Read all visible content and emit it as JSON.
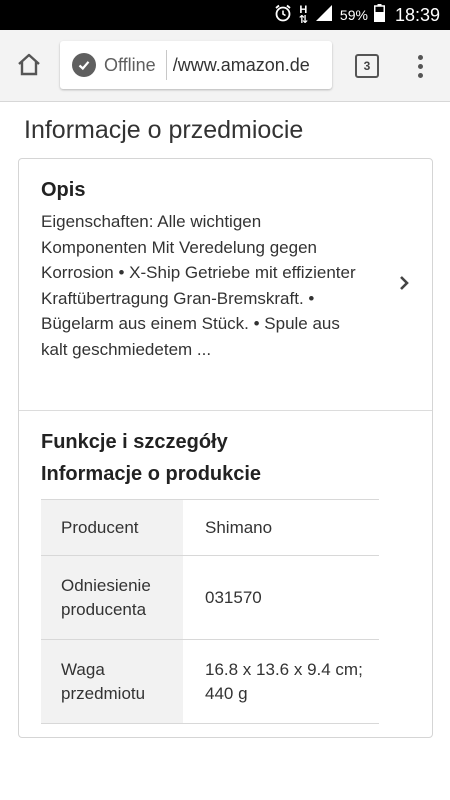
{
  "status_bar": {
    "network_label": "H",
    "battery": "59%",
    "time": "18:39"
  },
  "browser": {
    "offline_label": "Offline",
    "url": "/www.amazon.de",
    "tab_count": "3",
    "icons": [
      "home-icon",
      "offline-check-icon",
      "tabs-icon",
      "overflow-menu-icon"
    ]
  },
  "page": {
    "title": "Informacje o przedmiocie",
    "description": {
      "title": "Opis",
      "text": "Eigenschaften: Alle wichtigen Komponenten Mit Veredelung gegen Korrosion • X-Ship Getriebe mit effizienter Kraftübertragung Gran-Bremskraft. • Bügelarm aus einem Stück. • Spule aus kalt geschmiedetem ..."
    },
    "features": {
      "title": "Funkcje i szczegóły",
      "info_title": "Informacje o produkcie",
      "rows": [
        {
          "label": "Producent",
          "value": "Shimano"
        },
        {
          "label": "Odniesienie producenta",
          "value": "031570"
        },
        {
          "label": "Waga przedmiotu",
          "value": "16.8 x 13.6 x 9.4 cm; 440 g"
        }
      ]
    }
  }
}
